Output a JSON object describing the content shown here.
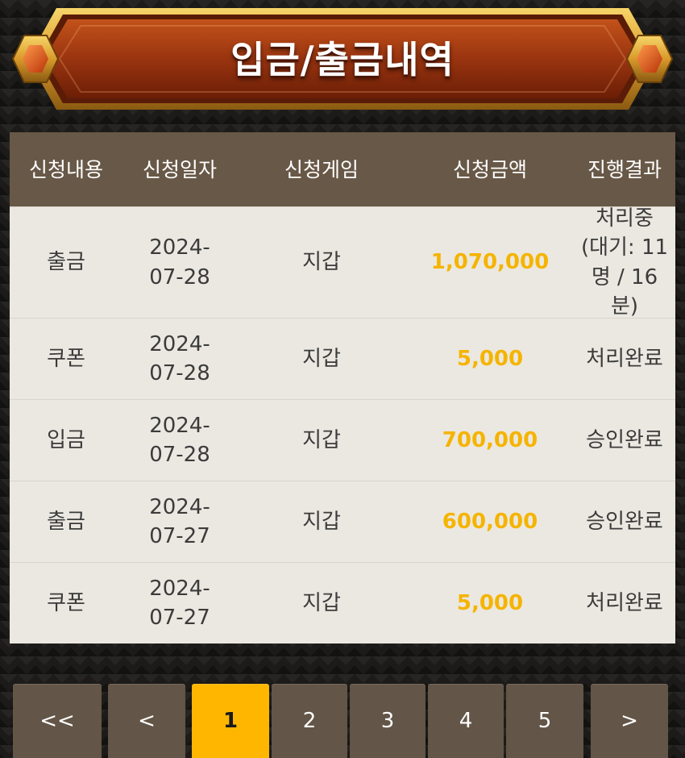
{
  "title": "입금/출금내역",
  "columns": [
    "신청내용",
    "신청일자",
    "신청게임",
    "신청금액",
    "진행결과"
  ],
  "rows": [
    {
      "type": "출금",
      "date": "2024-07-28",
      "game": "지갑",
      "amount": "1,070,000",
      "status": "처리중 (대기: 11명 / 16분)"
    },
    {
      "type": "쿠폰",
      "date": "2024-07-28",
      "game": "지갑",
      "amount": "5,000",
      "status": "처리완료"
    },
    {
      "type": "입금",
      "date": "2024-07-28",
      "game": "지갑",
      "amount": "700,000",
      "status": "승인완료"
    },
    {
      "type": "출금",
      "date": "2024-07-27",
      "game": "지갑",
      "amount": "600,000",
      "status": "승인완료"
    },
    {
      "type": "쿠폰",
      "date": "2024-07-27",
      "game": "지갑",
      "amount": "5,000",
      "status": "처리완료"
    }
  ],
  "pagination": {
    "first": "<<",
    "prev": "<",
    "pages": [
      "1",
      "2",
      "3",
      "4",
      "5"
    ],
    "current": "1",
    "next": ">"
  },
  "colors": {
    "amount": "#f5b400",
    "header_bg": "#685847",
    "active_page": "#ffb600",
    "banner_red": "#a43a10",
    "banner_gold": "#e3b23c"
  }
}
